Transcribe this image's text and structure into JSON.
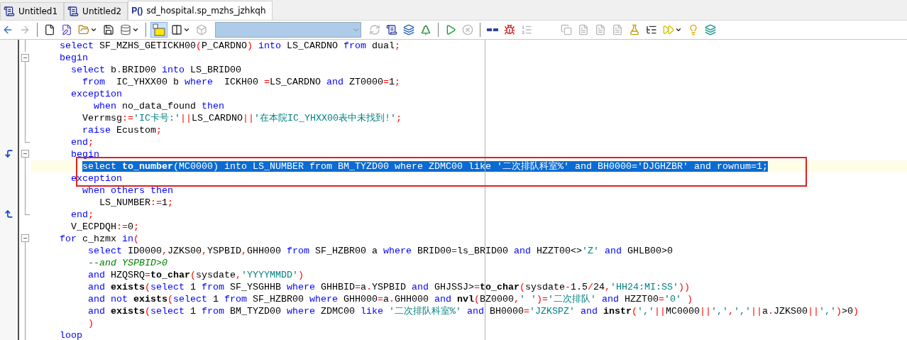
{
  "tabs": [
    {
      "label": "Untitled1",
      "kind": "sql",
      "selected": false
    },
    {
      "label": "Untitled2",
      "kind": "sql",
      "selected": false
    },
    {
      "label": "sd_hospital.sp_mzhs_jzhkqh",
      "kind": "procedure",
      "icon_label": "P()",
      "selected": true
    }
  ],
  "toolbar": [
    {
      "kind": "back",
      "disabled": false,
      "selected": false,
      "dropdown": false
    },
    {
      "kind": "forward",
      "disabled": true,
      "selected": false,
      "dropdown": false
    },
    {
      "kind": "sep"
    },
    {
      "kind": "new",
      "disabled": false,
      "selected": false,
      "dropdown": false
    },
    {
      "kind": "edit",
      "disabled": false,
      "selected": false,
      "dropdown": false
    },
    {
      "kind": "open",
      "disabled": false,
      "selected": false,
      "dropdown": true
    },
    {
      "kind": "save",
      "disabled": false,
      "selected": false,
      "dropdown": false
    },
    {
      "kind": "database",
      "disabled": false,
      "selected": false,
      "dropdown": true
    },
    {
      "kind": "sep"
    },
    {
      "kind": "text",
      "disabled": false,
      "selected": true,
      "dropdown": false
    },
    {
      "kind": "columns",
      "disabled": false,
      "selected": false,
      "dropdown": true
    },
    {
      "kind": "cube",
      "disabled": true,
      "selected": false,
      "dropdown": false
    },
    {
      "kind": "combo"
    },
    {
      "kind": "refresh",
      "disabled": true,
      "selected": false,
      "dropdown": false
    },
    {
      "kind": "script",
      "disabled": false,
      "selected": false,
      "dropdown": false
    },
    {
      "kind": "stack",
      "disabled": false,
      "selected": false,
      "dropdown": false
    },
    {
      "kind": "trees",
      "disabled": false,
      "selected": false,
      "dropdown": false
    },
    {
      "kind": "sep"
    },
    {
      "kind": "run",
      "disabled": false,
      "selected": false,
      "dropdown": false
    },
    {
      "kind": "stop",
      "disabled": true,
      "selected": false,
      "dropdown": false
    },
    {
      "kind": "sep"
    },
    {
      "kind": "dashes",
      "disabled": false,
      "selected": false,
      "dropdown": false
    },
    {
      "kind": "bug",
      "disabled": false,
      "selected": false,
      "dropdown": false
    },
    {
      "kind": "list",
      "disabled": true,
      "selected": false,
      "dropdown": false
    },
    {
      "kind": "gap"
    },
    {
      "kind": "copy",
      "disabled": true,
      "selected": false,
      "dropdown": false
    },
    {
      "kind": "doc",
      "disabled": true,
      "selected": false,
      "dropdown": false
    },
    {
      "kind": "doc",
      "disabled": true,
      "selected": false,
      "dropdown": false
    },
    {
      "kind": "doc",
      "disabled": true,
      "selected": false,
      "dropdown": false
    },
    {
      "kind": "flask",
      "disabled": false,
      "selected": false,
      "dropdown": false
    },
    {
      "kind": "tree",
      "disabled": false,
      "selected": false,
      "dropdown": false
    },
    {
      "kind": "fastforward",
      "disabled": false,
      "selected": false,
      "dropdown": true
    },
    {
      "kind": "bulb",
      "disabled": false,
      "selected": false,
      "dropdown": false
    },
    {
      "kind": "layers",
      "disabled": false,
      "selected": false,
      "dropdown": false
    }
  ],
  "annotation": {
    "kind": "red-rectangle"
  },
  "lines": [
    {
      "selected": false,
      "fold": {
        "kind": "line"
      },
      "tokens": [
        {
          "kind": "kw",
          "text": "     select"
        },
        {
          "kind": "id",
          "text": " SF_MZHS_GETICKH00"
        },
        {
          "kind": "op",
          "text": "("
        },
        {
          "kind": "id",
          "text": "P_CARDNO"
        },
        {
          "kind": "op",
          "text": ")"
        },
        {
          "kind": "kw",
          "text": " into"
        },
        {
          "kind": "id",
          "text": " LS_CARDNO "
        },
        {
          "kind": "kw",
          "text": "from"
        },
        {
          "kind": "id",
          "text": " dual"
        },
        {
          "kind": "op",
          "text": ";"
        }
      ]
    },
    {
      "selected": false,
      "fold": {
        "kind": "open"
      },
      "tokens": [
        {
          "kind": "kw",
          "text": "     begin"
        }
      ]
    },
    {
      "selected": false,
      "fold": {
        "kind": "line"
      },
      "tokens": [
        {
          "kind": "kw",
          "text": "       select"
        },
        {
          "kind": "id",
          "text": " b"
        },
        {
          "kind": "op",
          "text": "."
        },
        {
          "kind": "id",
          "text": "BRID00 "
        },
        {
          "kind": "kw",
          "text": "into"
        },
        {
          "kind": "id",
          "text": " LS_BRID00"
        }
      ]
    },
    {
      "selected": false,
      "fold": {
        "kind": "line"
      },
      "tokens": [
        {
          "kind": "kw",
          "text": "         from"
        },
        {
          "kind": "id",
          "text": "  IC_YHXX00 b "
        },
        {
          "kind": "kw",
          "text": "where"
        },
        {
          "kind": "id",
          "text": "  ICKH00 "
        },
        {
          "kind": "op",
          "text": "="
        },
        {
          "kind": "id",
          "text": "LS_CARDNO "
        },
        {
          "kind": "kw",
          "text": "and"
        },
        {
          "kind": "id",
          "text": " ZT0000"
        },
        {
          "kind": "op",
          "text": "="
        },
        {
          "kind": "id",
          "text": "1"
        },
        {
          "kind": "op",
          "text": ";"
        }
      ]
    },
    {
      "selected": false,
      "fold": {
        "kind": "line"
      },
      "tokens": [
        {
          "kind": "kw",
          "text": "       exception"
        }
      ]
    },
    {
      "selected": false,
      "fold": {
        "kind": "line"
      },
      "tokens": [
        {
          "kind": "kw",
          "text": "           when"
        },
        {
          "kind": "id",
          "text": " no_data_found "
        },
        {
          "kind": "kw",
          "text": "then"
        }
      ]
    },
    {
      "selected": false,
      "fold": {
        "kind": "line"
      },
      "tokens": [
        {
          "kind": "id",
          "text": "         Verrmsg"
        },
        {
          "kind": "op",
          "text": ":="
        },
        {
          "kind": "str",
          "text": "'IC卡号:'"
        },
        {
          "kind": "op",
          "text": "||"
        },
        {
          "kind": "id",
          "text": "LS_CARDNO"
        },
        {
          "kind": "op",
          "text": "||"
        },
        {
          "kind": "str",
          "text": "'在本院IC_YHXX00表中未找到!'"
        },
        {
          "kind": "op",
          "text": ";"
        }
      ]
    },
    {
      "selected": false,
      "fold": {
        "kind": "line"
      },
      "tokens": [
        {
          "kind": "kw",
          "text": "         raise"
        },
        {
          "kind": "id",
          "text": " Ecustom"
        },
        {
          "kind": "op",
          "text": ";"
        }
      ]
    },
    {
      "selected": false,
      "fold": {
        "kind": "end"
      },
      "tokens": [
        {
          "kind": "kw",
          "text": "       end"
        },
        {
          "kind": "op",
          "text": ";"
        }
      ]
    },
    {
      "selected": false,
      "fold": {
        "kind": "open"
      },
      "marker": {
        "kind": "jump-down"
      },
      "tokens": [
        {
          "kind": "kw",
          "text": "       begin"
        }
      ]
    },
    {
      "selected": true,
      "fold": {
        "kind": "line"
      },
      "tokens": [
        {
          "kind": "kw",
          "text": "         select"
        },
        {
          "kind": "fn",
          "text": " to_number"
        },
        {
          "kind": "op",
          "text": "("
        },
        {
          "kind": "id",
          "text": "MC0000"
        },
        {
          "kind": "op",
          "text": ")"
        },
        {
          "kind": "kw",
          "text": " into"
        },
        {
          "kind": "id",
          "text": " LS_NUMBER "
        },
        {
          "kind": "kw",
          "text": "from"
        },
        {
          "kind": "id",
          "text": " BM_TYZD00 "
        },
        {
          "kind": "kw",
          "text": "where"
        },
        {
          "kind": "id",
          "text": " ZDMC00 "
        },
        {
          "kind": "kw",
          "text": "like"
        },
        {
          "kind": "str",
          "text": " '二次排队科室%'"
        },
        {
          "kind": "kw",
          "text": " and"
        },
        {
          "kind": "id",
          "text": " BH0000"
        },
        {
          "kind": "op",
          "text": "="
        },
        {
          "kind": "str",
          "text": "'DJGHZBR'"
        },
        {
          "kind": "kw",
          "text": " and"
        },
        {
          "kind": "id",
          "text": " rownum"
        },
        {
          "kind": "op",
          "text": "="
        },
        {
          "kind": "id",
          "text": "1"
        },
        {
          "kind": "op",
          "text": ";"
        }
      ]
    },
    {
      "selected": false,
      "fold": {
        "kind": "line"
      },
      "tokens": [
        {
          "kind": "kw",
          "text": "       exception"
        }
      ]
    },
    {
      "selected": false,
      "fold": {
        "kind": "line"
      },
      "tokens": [
        {
          "kind": "kw",
          "text": "         when"
        },
        {
          "kind": "kw",
          "text": " others"
        },
        {
          "kind": "kw",
          "text": " then"
        }
      ]
    },
    {
      "selected": false,
      "fold": {
        "kind": "line"
      },
      "tokens": [
        {
          "kind": "id",
          "text": "            LS_NUMBER"
        },
        {
          "kind": "op",
          "text": ":="
        },
        {
          "kind": "id",
          "text": "1"
        },
        {
          "kind": "op",
          "text": ";"
        }
      ]
    },
    {
      "selected": false,
      "fold": {
        "kind": "end"
      },
      "marker": {
        "kind": "jump-up"
      },
      "tokens": [
        {
          "kind": "kw",
          "text": "       end"
        },
        {
          "kind": "op",
          "text": ";"
        }
      ]
    },
    {
      "selected": false,
      "tokens": [
        {
          "kind": "id",
          "text": "       V_ECPDQH"
        },
        {
          "kind": "op",
          "text": ":="
        },
        {
          "kind": "id",
          "text": "0"
        },
        {
          "kind": "op",
          "text": ";"
        }
      ]
    },
    {
      "selected": false,
      "fold": {
        "kind": "open"
      },
      "tokens": [
        {
          "kind": "kw",
          "text": "     for"
        },
        {
          "kind": "id",
          "text": " c_hzmx "
        },
        {
          "kind": "kw",
          "text": "in"
        },
        {
          "kind": "op",
          "text": "("
        }
      ]
    },
    {
      "selected": false,
      "fold": {
        "kind": "line"
      },
      "tokens": [
        {
          "kind": "kw",
          "text": "          select"
        },
        {
          "kind": "id",
          "text": " ID0000"
        },
        {
          "kind": "op",
          "text": ","
        },
        {
          "kind": "id",
          "text": "JZKS00"
        },
        {
          "kind": "op",
          "text": ","
        },
        {
          "kind": "id",
          "text": "YSPBID"
        },
        {
          "kind": "op",
          "text": ","
        },
        {
          "kind": "id",
          "text": "GHH000 "
        },
        {
          "kind": "kw",
          "text": "from"
        },
        {
          "kind": "id",
          "text": " SF_HZBR00 a "
        },
        {
          "kind": "kw",
          "text": "where"
        },
        {
          "kind": "id",
          "text": " BRID00"
        },
        {
          "kind": "op",
          "text": "="
        },
        {
          "kind": "id",
          "text": "ls_BRID00 "
        },
        {
          "kind": "kw",
          "text": "and"
        },
        {
          "kind": "id",
          "text": " HZZT00<>"
        },
        {
          "kind": "str",
          "text": "'Z'"
        },
        {
          "kind": "kw",
          "text": " and"
        },
        {
          "kind": "id",
          "text": " GHLB00>0"
        }
      ]
    },
    {
      "selected": false,
      "fold": {
        "kind": "line"
      },
      "tokens": [
        {
          "kind": "cm",
          "text": "          --and YSPBID>0"
        }
      ]
    },
    {
      "selected": false,
      "fold": {
        "kind": "line"
      },
      "tokens": [
        {
          "kind": "kw",
          "text": "          and"
        },
        {
          "kind": "id",
          "text": " HZQSRQ"
        },
        {
          "kind": "op",
          "text": "="
        },
        {
          "kind": "fn",
          "text": "to_char"
        },
        {
          "kind": "op",
          "text": "("
        },
        {
          "kind": "id",
          "text": "sysdate"
        },
        {
          "kind": "op",
          "text": ","
        },
        {
          "kind": "str",
          "text": "'YYYYMMDD'"
        },
        {
          "kind": "op",
          "text": ")"
        }
      ]
    },
    {
      "selected": false,
      "fold": {
        "kind": "line"
      },
      "tokens": [
        {
          "kind": "kw",
          "text": "          and"
        },
        {
          "kind": "fn",
          "text": " exists"
        },
        {
          "kind": "op",
          "text": "("
        },
        {
          "kind": "kw",
          "text": "select"
        },
        {
          "kind": "id",
          "text": " 1 "
        },
        {
          "kind": "kw",
          "text": "from"
        },
        {
          "kind": "id",
          "text": " SF_YSGHHB "
        },
        {
          "kind": "kw",
          "text": "where"
        },
        {
          "kind": "id",
          "text": " GHHBID"
        },
        {
          "kind": "op",
          "text": "="
        },
        {
          "kind": "id",
          "text": "a"
        },
        {
          "kind": "op",
          "text": "."
        },
        {
          "kind": "id",
          "text": "YSPBID "
        },
        {
          "kind": "kw",
          "text": "and"
        },
        {
          "kind": "id",
          "text": " GHJSSJ>"
        },
        {
          "kind": "op",
          "text": "="
        },
        {
          "kind": "fn",
          "text": "to_char"
        },
        {
          "kind": "op",
          "text": "("
        },
        {
          "kind": "id",
          "text": "sysdate"
        },
        {
          "kind": "op",
          "text": "-"
        },
        {
          "kind": "id",
          "text": "1.5"
        },
        {
          "kind": "op",
          "text": "/"
        },
        {
          "kind": "id",
          "text": "24"
        },
        {
          "kind": "op",
          "text": ","
        },
        {
          "kind": "str",
          "text": "'HH24:MI:SS'"
        },
        {
          "kind": "op",
          "text": "))"
        }
      ]
    },
    {
      "selected": false,
      "fold": {
        "kind": "line"
      },
      "tokens": [
        {
          "kind": "kw",
          "text": "          and"
        },
        {
          "kind": "kw",
          "text": " not"
        },
        {
          "kind": "fn",
          "text": " exists"
        },
        {
          "kind": "op",
          "text": "("
        },
        {
          "kind": "kw",
          "text": "select"
        },
        {
          "kind": "id",
          "text": " 1 "
        },
        {
          "kind": "kw",
          "text": "from"
        },
        {
          "kind": "id",
          "text": " SF_HZBR00 "
        },
        {
          "kind": "kw",
          "text": "where"
        },
        {
          "kind": "id",
          "text": " GHH000"
        },
        {
          "kind": "op",
          "text": "="
        },
        {
          "kind": "id",
          "text": "a"
        },
        {
          "kind": "op",
          "text": "."
        },
        {
          "kind": "id",
          "text": "GHH000 "
        },
        {
          "kind": "kw",
          "text": "and"
        },
        {
          "kind": "fn",
          "text": " nvl"
        },
        {
          "kind": "op",
          "text": "("
        },
        {
          "kind": "id",
          "text": "BZ0000"
        },
        {
          "kind": "op",
          "text": ","
        },
        {
          "kind": "str",
          "text": "' '"
        },
        {
          "kind": "op",
          "text": ")="
        },
        {
          "kind": "str",
          "text": "'二次排队'"
        },
        {
          "kind": "kw",
          "text": " and"
        },
        {
          "kind": "id",
          "text": " HZZT00"
        },
        {
          "kind": "op",
          "text": "="
        },
        {
          "kind": "str",
          "text": "'0'"
        },
        {
          "kind": "op",
          "text": " )"
        }
      ]
    },
    {
      "selected": false,
      "fold": {
        "kind": "line"
      },
      "tokens": [
        {
          "kind": "kw",
          "text": "          and"
        },
        {
          "kind": "fn",
          "text": " exists"
        },
        {
          "kind": "op",
          "text": "("
        },
        {
          "kind": "kw",
          "text": "select"
        },
        {
          "kind": "id",
          "text": " 1 "
        },
        {
          "kind": "kw",
          "text": "from"
        },
        {
          "kind": "id",
          "text": " BM_TYZD00 "
        },
        {
          "kind": "kw",
          "text": "where"
        },
        {
          "kind": "id",
          "text": " ZDMC00 "
        },
        {
          "kind": "kw",
          "text": "like"
        },
        {
          "kind": "str",
          "text": " '二次排队科室%'"
        },
        {
          "kind": "kw",
          "text": " and"
        },
        {
          "kind": "id",
          "text": " BH0000"
        },
        {
          "kind": "op",
          "text": "="
        },
        {
          "kind": "str",
          "text": "'JZKSPZ'"
        },
        {
          "kind": "kw",
          "text": " and"
        },
        {
          "kind": "fn",
          "text": " instr"
        },
        {
          "kind": "op",
          "text": "("
        },
        {
          "kind": "str",
          "text": "','"
        },
        {
          "kind": "op",
          "text": "||"
        },
        {
          "kind": "id",
          "text": "MC0000"
        },
        {
          "kind": "op",
          "text": "||"
        },
        {
          "kind": "str",
          "text": "','"
        },
        {
          "kind": "op",
          "text": ","
        },
        {
          "kind": "str",
          "text": "','"
        },
        {
          "kind": "op",
          "text": "||"
        },
        {
          "kind": "id",
          "text": "a"
        },
        {
          "kind": "op",
          "text": "."
        },
        {
          "kind": "id",
          "text": "JZKS00"
        },
        {
          "kind": "op",
          "text": "||"
        },
        {
          "kind": "str",
          "text": "','"
        },
        {
          "kind": "op",
          "text": ")"
        },
        {
          "kind": "id",
          "text": ">0"
        },
        {
          "kind": "op",
          "text": ")"
        }
      ]
    },
    {
      "selected": false,
      "fold": {
        "kind": "line"
      },
      "tokens": [
        {
          "kind": "op",
          "text": "          )"
        }
      ]
    },
    {
      "selected": false,
      "fold": {
        "kind": "line"
      },
      "tokens": [
        {
          "kind": "kw",
          "text": "     loop"
        }
      ]
    }
  ]
}
